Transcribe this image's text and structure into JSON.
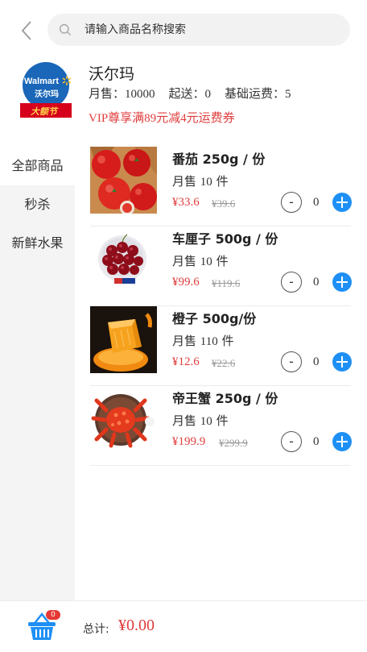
{
  "header": {
    "search_placeholder": "请输入商品名称搜索"
  },
  "store": {
    "logo_text": "Walmart",
    "logo_cn": "沃尔玛",
    "logo_banner": "大额节",
    "name": "沃尔玛",
    "monthly_sales": "月售：10000",
    "min_order": "起送：0",
    "base_fee": "基础运费：5",
    "promo": "VIP尊享满89元减4元运费券"
  },
  "sidebar": {
    "categories": [
      {
        "label": "全部商品",
        "active": true
      },
      {
        "label": "秒杀",
        "active": false
      },
      {
        "label": "新鲜水果",
        "active": false
      }
    ]
  },
  "products": [
    {
      "name": "番茄 250g / 份",
      "sold_prefix": "月售",
      "sold_count": "10",
      "sold_suffix": "件",
      "price": "¥33.6",
      "original_price": "¥39.6",
      "quantity": "0",
      "image": "tomato-image"
    },
    {
      "name": "车厘子 500g / 份",
      "sold_prefix": "月售",
      "sold_count": "10",
      "sold_suffix": "件",
      "price": "¥99.6",
      "original_price": "¥119.6",
      "quantity": "0",
      "image": "cherry-image"
    },
    {
      "name": "橙子 500g/份",
      "sold_prefix": "月售",
      "sold_count": "110",
      "sold_suffix": "件",
      "price": "¥12.6",
      "original_price": "¥22.6",
      "quantity": "0",
      "image": "orange-image"
    },
    {
      "name": "帝王蟹 250g / 份",
      "sold_prefix": "月售",
      "sold_count": "10",
      "sold_suffix": "件",
      "price": "¥199.9",
      "original_price": "¥299.9",
      "quantity": "0",
      "image": "crab-image"
    }
  ],
  "footer": {
    "cart_count": "0",
    "total_label": "总计:",
    "total_value": "¥0.00"
  },
  "colors": {
    "accent": "#1e90f5",
    "price_red": "#e03c3c",
    "badge_red": "#e53935"
  }
}
